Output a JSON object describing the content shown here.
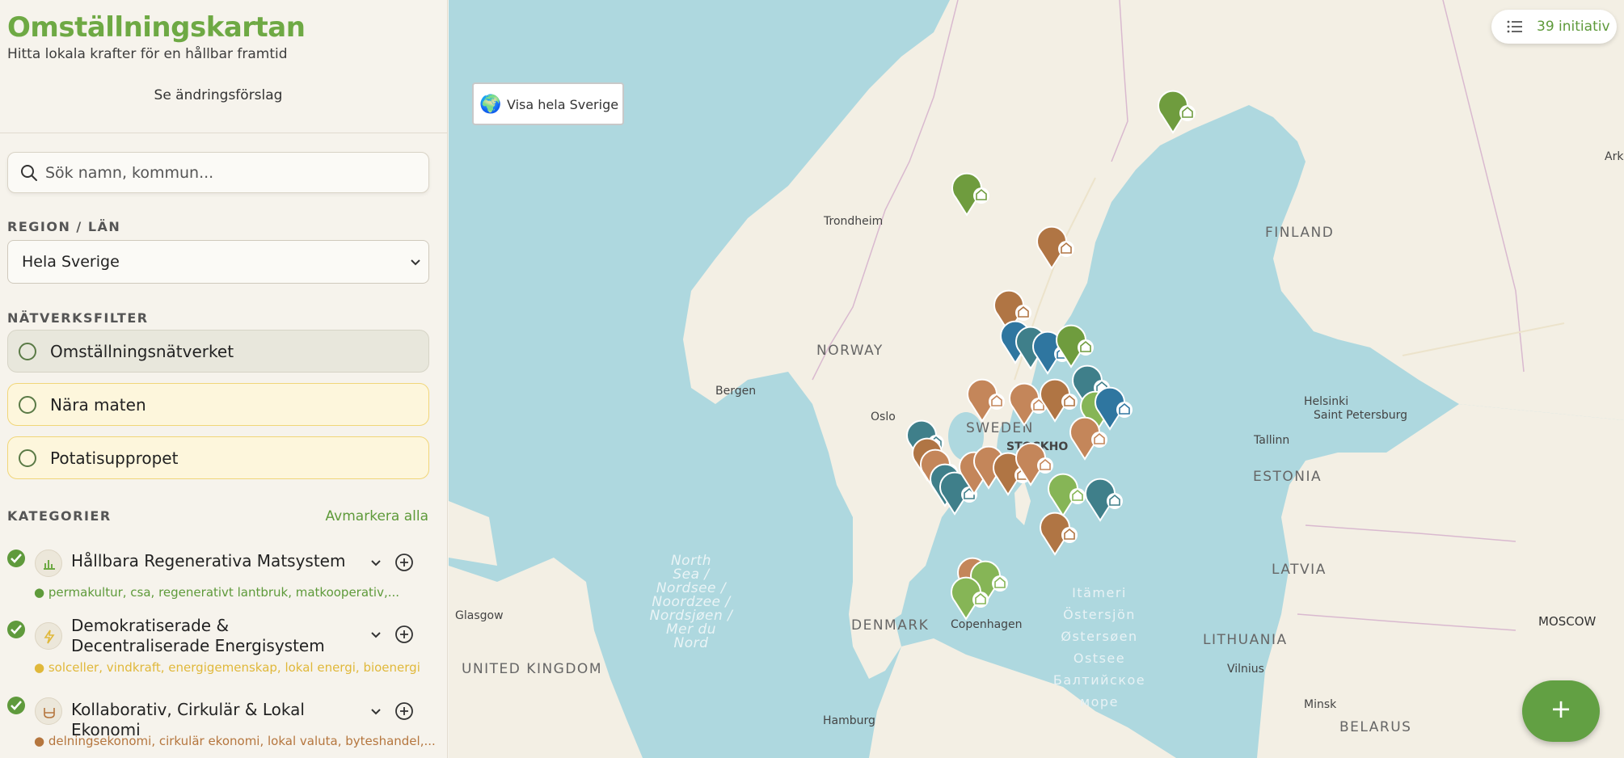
{
  "app": {
    "title": "Omställningskartan",
    "tagline": "Hitta lokala krafter för en hållbar framtid",
    "suggest_link": "Se ändringsförslag"
  },
  "search": {
    "placeholder": "Sök namn, kommun..."
  },
  "region": {
    "label": "REGION / LÄN",
    "selected": "Hela Sverige"
  },
  "network": {
    "label": "NÄTVERKSFILTER",
    "filters": [
      "Omställningsnätverket",
      "Nära maten",
      "Potatisuppropet"
    ]
  },
  "categories": {
    "label": "KATEGORIER",
    "deselect_all": "Avmarkera alla",
    "items": [
      {
        "name": "Hållbara Regenerativa Matsystem",
        "tags": "● permakultur, csa, regenerativt lantbruk, matkooperativ,...",
        "color": "#5e9a3a",
        "icon": "plant-icon"
      },
      {
        "name": "Demokratiserade & Decentraliserade Energisystem",
        "tags": "● solceller, vindkraft, energigemenskap, lokal energi, bioenergi",
        "color": "#e0b83a",
        "icon": "lightning-icon"
      },
      {
        "name": "Kollaborativ, Cirkulär & Lokal Ekonomi",
        "tags": "● delningsekonomi, cirkulär ekonomi, lokal valuta, byteshandel,...",
        "color": "#b5763e",
        "icon": "basket-icon"
      }
    ]
  },
  "map": {
    "show_sweden": "Visa hela Sverige",
    "initiative_count": "39 initiativ",
    "fab": "+",
    "countries": {
      "norway": "NORWAY",
      "sweden": "SWEDEN",
      "finland": "FINLAND",
      "estonia": "ESTONIA",
      "latvia": "LATVIA",
      "lithuania": "LITHUANIA",
      "denmark": "DENMARK",
      "united_kingdom": "UNITED KINGDOM",
      "belarus": "BELARUS",
      "moscow": "MOSCOW"
    },
    "cities": {
      "trondheim": "Trondheim",
      "bergen": "Bergen",
      "oslo": "Oslo",
      "stockholm": "STOCKHO",
      "helsinki": "Helsinki",
      "st_petersburg": "Saint Petersburg",
      "tallinn": "Tallinn",
      "copenhagen": "Copenhagen",
      "glasgow": "Glasgow",
      "hamburg": "Hamburg",
      "vilnius": "Vilnius",
      "minsk": "Minsk",
      "ark": "Ark"
    },
    "seas": {
      "north_sea": "North\nSea /\nNordsee /\nNoordzee /\nNordsjøen /\nMer du\nNord",
      "baltic": "Itämeri\nÖstersjön\nØstersøen\nOstsee\nБалтийское\nморе"
    },
    "pin_colors": {
      "food": "#6f9c3e",
      "light_green": "#86b556",
      "brown": "#b07544",
      "teal": "#3f7f8a",
      "blue": "#2f76a0",
      "tan": "#c4865a"
    }
  }
}
